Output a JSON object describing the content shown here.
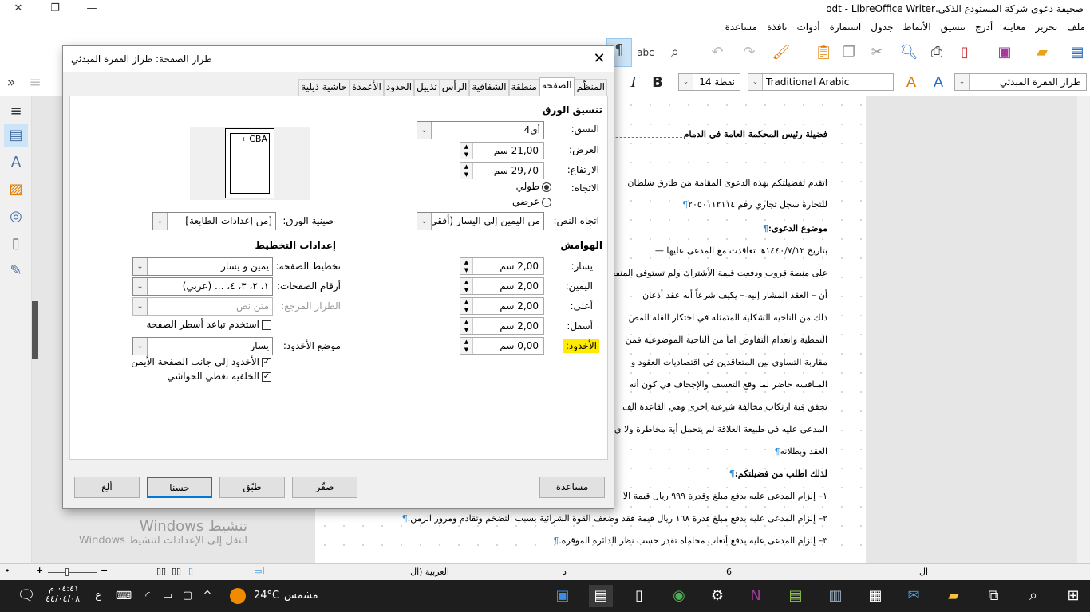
{
  "window": {
    "title": "صحيفة دعوى شركة المستودع الذكي.odt - LibreOffice Writer"
  },
  "menu": [
    "ملف",
    "تحرير",
    "معاينة",
    "أدرج",
    "تنسيق",
    "الأنماط",
    "جدول",
    "استمارة",
    "أدوات",
    "نافذة",
    "مساعدة"
  ],
  "toolbar": {
    "paragraph_style": "طراز الفقرة المبدئي",
    "font_name": "Traditional Arabic",
    "font_size": "نقطة 14",
    "bold": "B",
    "italic": "I"
  },
  "document": {
    "lines": [
      {
        "text": "فضيلة رئيس المحكمة العامة في الدمام",
        "bold": true
      },
      {
        "text": ""
      },
      {
        "text": "اتقدم لفضيلتكم بهذه الدعوى المقامة من طارق سلطان"
      },
      {
        "text": "للتجارة سجل تجاري رقم ٢٠٥٠١١٢١١٤",
        "para": true
      },
      {
        "text": "موضوع الدعوى:",
        "bold": true,
        "para": true
      },
      {
        "text": "بتاريخ ١٤٤٠/٧/١٢هـ تعاقدت مع المدعى عليها —"
      },
      {
        "text": "على منصة قروب ودفعت قيمة الأشتراك ولم تستوفي المنفعة"
      },
      {
        "text": "أن – العقد المشار إليه – يكيف شرعاً أنه عقد أذعان"
      },
      {
        "text": "ذلك من الناحية الشكلية المتمثلة في احتكار القلة المص"
      },
      {
        "text": "النمطية وانعدام التفاوض اما من الناحية الموضوعية فمن"
      },
      {
        "text": "مقاربة التساوي بين المتعاقدين في اقتصاديات العقود و"
      },
      {
        "text": "المنافسة حاضر لما وقع التعسف والإجحاف في كون أنه"
      },
      {
        "text": "تحقق فية ارتكاب مخالفة شرعية اخرى وهي القاعدة الف"
      },
      {
        "text": "المدعى عليه في طبيعة العلاقة لم يتحمل أية مخاطرة ولا ي"
      },
      {
        "text": "العقد وبطلانه",
        "para": true
      },
      {
        "text": "لذلك اطلب من فضيلتكم:",
        "bold": true,
        "para": true
      },
      {
        "text": "١– إلزام المدعى عليه بدفع مبلغ وقدرة ٩٩٩ ريال قيمة الا"
      },
      {
        "text": "٢– إلزام المدعى عليه بدفع مبلغ قدرة ١٦٨ ريال قيمة فقد وضعف القوة الشرائية بسبب التضخم وتقادم ومرور الزمن.",
        "para": true
      },
      {
        "text": "٣– إلزام المدعى عليه بدفع أتعاب محاماة تقدر حسب نظر الدائرة الموقرة.",
        "para": true
      }
    ]
  },
  "dialog": {
    "title": "طراز الصفحة: طراز الفقرة المبدئي",
    "tabs": [
      "المنظّم",
      "الصفحة",
      "منطقة",
      "الشفافية",
      "الرأس",
      "تذييل",
      "الحدود",
      "الأعمدة",
      "حاشية ذيلية"
    ],
    "active_tab": "الصفحة",
    "paper_format": {
      "heading": "تنسيق الورق",
      "format_label": "النسق:",
      "format_value": "أي4",
      "width_label": "العرض:",
      "width_value": "21,00 سم",
      "height_label": "الارتفاع:",
      "height_value": "29,70 سم",
      "orientation_label": "الاتجاه:",
      "portrait": "طولي",
      "landscape": "عرضي",
      "orientation": "portrait",
      "text_direction_label": "اتجاه النص:",
      "text_direction_value": "من اليمين إلى اليسار (أفقي)",
      "paper_tray_label": "صينية الورق:",
      "paper_tray_value": "[من إعدادات الطابعة]",
      "preview_text": "←CBA"
    },
    "margins": {
      "heading": "الهوامش",
      "left_label": "يسار:",
      "left": "2,00 سم",
      "right_label": "اليمين:",
      "right": "2,00 سم",
      "top_label": "أعلى:",
      "top": "2,00 سم",
      "bottom_label": "أسفل:",
      "bottom": "2,00 سم",
      "gutter_label": "الأخدود:",
      "gutter": "0,00 سم"
    },
    "layout": {
      "heading": "إعدادات التخطيط",
      "page_layout_label": "تخطيط الصفحة:",
      "page_layout_value": "يمين و يسار",
      "page_numbers_label": "أرقام الصفحات:",
      "page_numbers_value": "١، ٢، ٣، ٤، ... (عربي)",
      "ref_style_label": "الطراز المرجع:",
      "ref_style_value": "متن نص",
      "register_true": "استخدم تباعد أسطر الصفحة",
      "register_true_checked": false,
      "gutter_pos_label": "موضع الأخدود:",
      "gutter_pos_value": "يسار",
      "gutter_right": "الأخدود إلى جانب الصفحة الأيمن",
      "gutter_right_checked": true,
      "bg_covers": "الخلفية تغطي الحواشي",
      "bg_covers_checked": true
    },
    "buttons": {
      "help": "مساعدة",
      "reset": "صفّر",
      "apply": "طبّق",
      "ok": "حسنا",
      "cancel": "ألغ"
    }
  },
  "watermark": {
    "line1": "تنشيط Windows",
    "line2": "انتقل إلى الإعدادات لتنشيط Windows"
  },
  "statusbar": {
    "language": "العربية (ال",
    "page_col": "6",
    "d": "د",
    "al": "ال"
  },
  "taskbar": {
    "weather_label": "مشمس",
    "temperature": "24°C",
    "time": "٠٤:٤١ م",
    "date": "٤٤/٠٤/٠٨",
    "lang": "ع"
  }
}
